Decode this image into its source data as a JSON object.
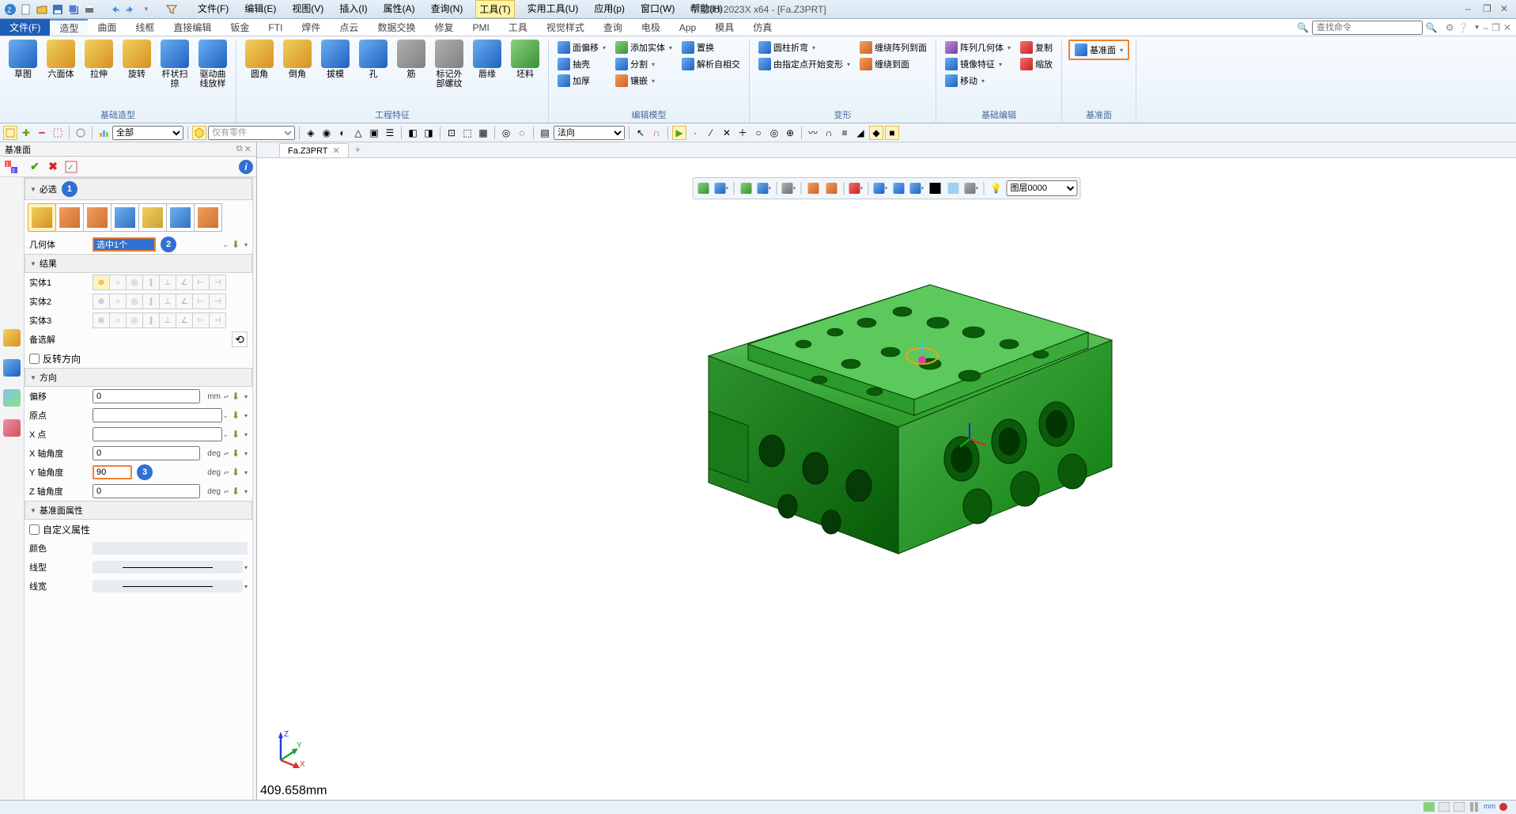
{
  "app": {
    "title": "中望3D 2023X x64 - [Fa.Z3PRT]"
  },
  "qat": [
    "new",
    "open",
    "save",
    "print",
    "cut",
    "copy",
    "paste",
    "undo",
    "redo",
    "filter"
  ],
  "menubar": [
    {
      "id": "file",
      "label": "文件(F)"
    },
    {
      "id": "edit",
      "label": "编辑(E)"
    },
    {
      "id": "view",
      "label": "视图(V)"
    },
    {
      "id": "insert",
      "label": "插入(I)"
    },
    {
      "id": "attr",
      "label": "属性(A)"
    },
    {
      "id": "query",
      "label": "查询(N)"
    },
    {
      "id": "tools",
      "label": "工具(T)",
      "active": true
    },
    {
      "id": "util",
      "label": "实用工具(U)"
    },
    {
      "id": "apply",
      "label": "应用(p)"
    },
    {
      "id": "window",
      "label": "窗口(W)"
    },
    {
      "id": "help",
      "label": "帮助(H)"
    }
  ],
  "ribbon_tabs": [
    {
      "id": "file",
      "label": "文件(F)",
      "file": true
    },
    {
      "id": "model",
      "label": "造型",
      "active": true
    },
    {
      "id": "surface",
      "label": "曲面"
    },
    {
      "id": "wire",
      "label": "线框"
    },
    {
      "id": "direct",
      "label": "直接编辑"
    },
    {
      "id": "sheet",
      "label": "钣金"
    },
    {
      "id": "fti",
      "label": "FTI"
    },
    {
      "id": "weld",
      "label": "焊件"
    },
    {
      "id": "pointcloud",
      "label": "点云"
    },
    {
      "id": "exchange",
      "label": "数据交换"
    },
    {
      "id": "repair",
      "label": "修复"
    },
    {
      "id": "pmi",
      "label": "PMI"
    },
    {
      "id": "tool",
      "label": "工具"
    },
    {
      "id": "viewstyle",
      "label": "视觉样式"
    },
    {
      "id": "query2",
      "label": "查询"
    },
    {
      "id": "electrode",
      "label": "电极"
    },
    {
      "id": "app",
      "label": "App"
    },
    {
      "id": "mold",
      "label": "模具"
    },
    {
      "id": "sim",
      "label": "仿真"
    }
  ],
  "search_placeholder": "查找命令",
  "ribbon_groups": {
    "base": {
      "label": "基础造型",
      "big": [
        {
          "id": "sketch",
          "label": "草图",
          "cls": "blue"
        },
        {
          "id": "box",
          "label": "六面体"
        },
        {
          "id": "extrude",
          "label": "拉伸"
        },
        {
          "id": "revolve",
          "label": "旋转"
        },
        {
          "id": "loft",
          "label": "杆状扫掠",
          "cls": "blue"
        },
        {
          "id": "sweep",
          "label": "驱动曲线放样",
          "cls": "blue"
        }
      ]
    },
    "feature": {
      "label": "工程特征",
      "big": [
        {
          "id": "fillet",
          "label": "圆角"
        },
        {
          "id": "chamfer",
          "label": "倒角"
        },
        {
          "id": "draft",
          "label": "拔模",
          "cls": "blue"
        },
        {
          "id": "hole",
          "label": "孔",
          "cls": "blue"
        },
        {
          "id": "rib",
          "label": "筋",
          "cls": "gray"
        },
        {
          "id": "thread",
          "label": "标记外部螺纹",
          "cls": "gray"
        },
        {
          "id": "lip",
          "label": "唇缘",
          "cls": "blue"
        },
        {
          "id": "blank",
          "label": "坯料",
          "cls": "green"
        }
      ]
    },
    "editmodel": {
      "label": "编辑模型",
      "items": [
        {
          "id": "faceoffset",
          "label": "面偏移"
        },
        {
          "id": "shell",
          "label": "抽壳"
        },
        {
          "id": "thicken",
          "label": "加厚"
        },
        {
          "id": "addbody",
          "label": "添加实体"
        },
        {
          "id": "split",
          "label": "分割"
        },
        {
          "id": "embed",
          "label": "镶嵌"
        },
        {
          "id": "replace",
          "label": "置换"
        },
        {
          "id": "intersect",
          "label": "解析自相交"
        }
      ]
    },
    "deform": {
      "label": "变形",
      "items": [
        {
          "id": "cylbend",
          "label": "圆柱折弯"
        },
        {
          "id": "ptdeform",
          "label": "由指定点开始变形"
        },
        {
          "id": "wraparray",
          "label": "缠绕阵列到面"
        },
        {
          "id": "wrapto",
          "label": "缠绕到面"
        }
      ]
    },
    "baseedit": {
      "label": "基础编辑",
      "items": [
        {
          "id": "patterngeom",
          "label": "阵列几何体"
        },
        {
          "id": "mirror",
          "label": "镜像特征"
        },
        {
          "id": "move",
          "label": "移动"
        },
        {
          "id": "copy",
          "label": "复制"
        },
        {
          "id": "scale",
          "label": "缩放"
        }
      ]
    },
    "datum": {
      "label": "基准面",
      "items": [
        {
          "id": "datumplane",
          "label": "基准面"
        }
      ]
    }
  },
  "filterbar": {
    "filter_select": "全部",
    "scope_select": "仅有零件",
    "vec_select": "法向"
  },
  "leftpanel": {
    "title": "基准面",
    "sections": {
      "required": {
        "label": "必选",
        "badge": "1"
      },
      "geometry": {
        "label": "几何体",
        "value": "选中1个",
        "badge": "2"
      },
      "result": {
        "label": "结果",
        "entities": [
          {
            "id": "e1",
            "label": "实体1"
          },
          {
            "id": "e2",
            "label": "实体2"
          },
          {
            "id": "e3",
            "label": "实体3"
          }
        ],
        "backup": "备选解",
        "reverse": "反转方向"
      },
      "direction": {
        "label": "方向",
        "rows": [
          {
            "id": "offset",
            "label": "偏移",
            "value": "0",
            "unit": "mm"
          },
          {
            "id": "origin",
            "label": "原点",
            "value": ""
          },
          {
            "id": "xpt",
            "label": "X 点",
            "value": ""
          },
          {
            "id": "xang",
            "label": "X 轴角度",
            "value": "0",
            "unit": "deg"
          },
          {
            "id": "yang",
            "label": "Y 轴角度",
            "value": "90",
            "unit": "deg",
            "badge": "3",
            "hl": true
          },
          {
            "id": "zang",
            "label": "Z 轴角度",
            "value": "0",
            "unit": "deg"
          }
        ]
      },
      "datumprops": {
        "label": "基准面属性",
        "custom": "自定义属性",
        "rows": [
          {
            "id": "color",
            "label": "颜色"
          },
          {
            "id": "linetype",
            "label": "线型"
          },
          {
            "id": "linewidth",
            "label": "线宽"
          }
        ]
      }
    }
  },
  "doc_tab": {
    "label": "Fa.Z3PRT"
  },
  "view_toolbar": {
    "layer_select": "图层0000"
  },
  "axes": {
    "x": "X",
    "y": "Y",
    "z": "Z"
  },
  "measurement": "409.658mm"
}
